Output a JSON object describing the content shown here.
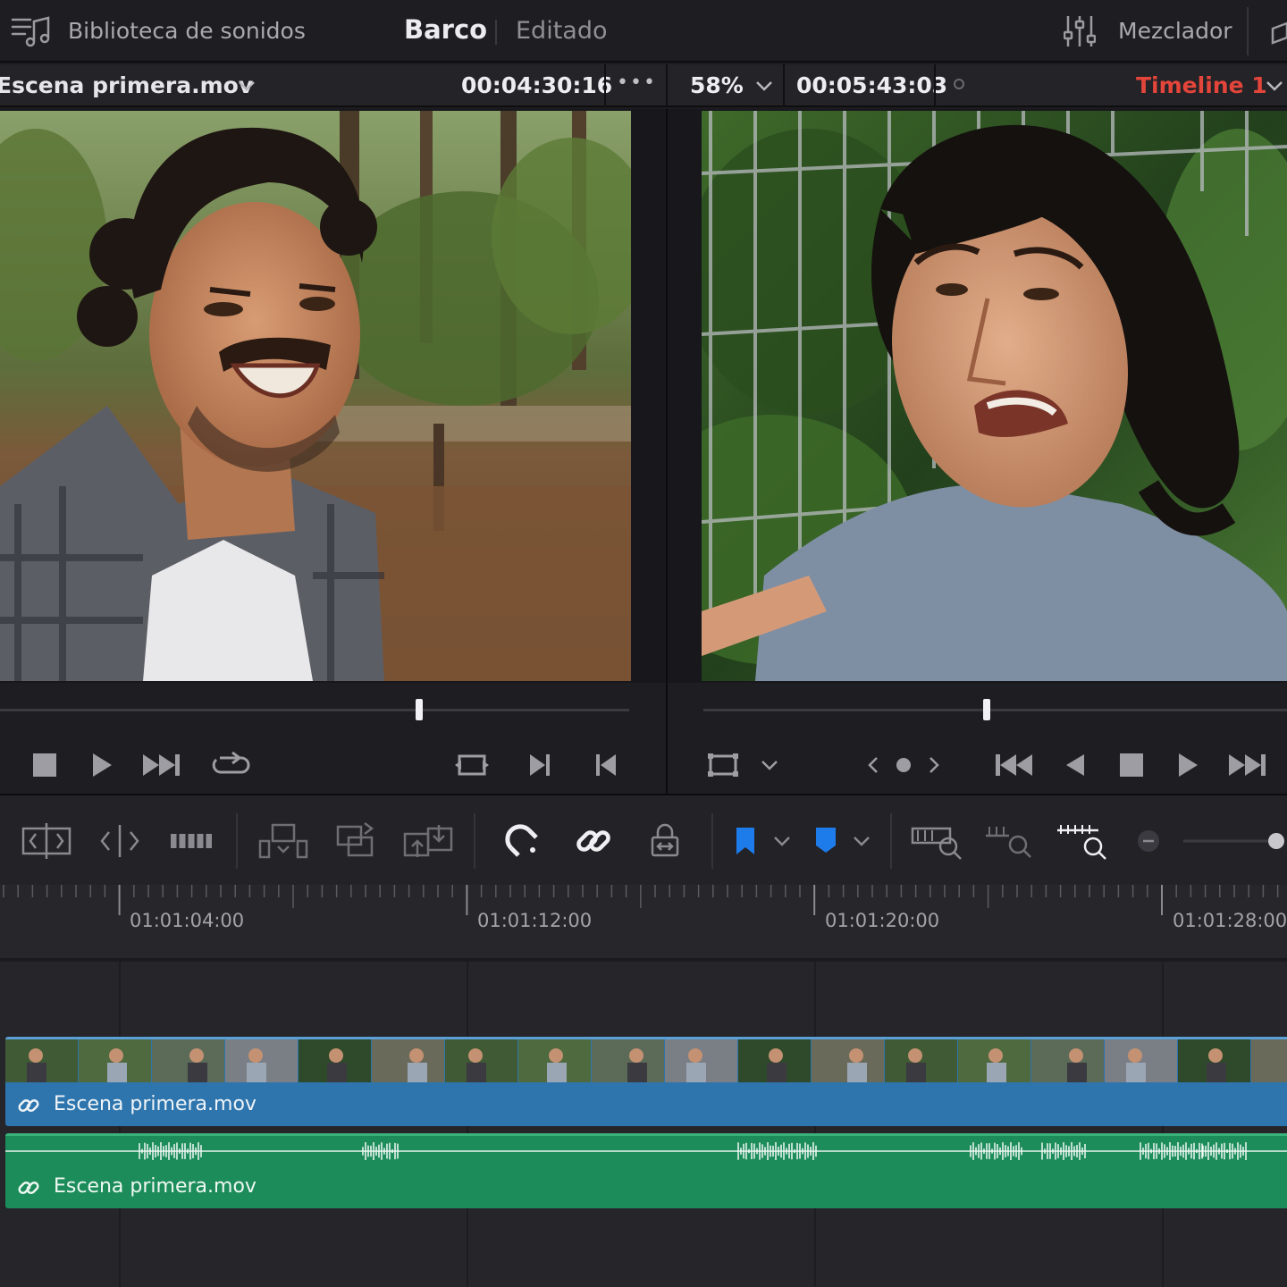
{
  "topbar": {
    "sound_library_label": "Biblioteca de sonidos",
    "page_title": "Barco",
    "page_mode": "Editado",
    "mixer_label": "Mezclador"
  },
  "source_viewer": {
    "clip_name": "Escena primera.mov",
    "timecode": "00:04:30:16",
    "more_label": "•••",
    "playhead_fraction": 0.66
  },
  "timeline_viewer": {
    "zoom": "58%",
    "timecode": "00:05:43:03",
    "timeline_name": "Timeline 1",
    "playhead_fraction": 0.48
  },
  "ruler": {
    "labels": [
      "01:01:04:00",
      "01:01:12:00",
      "01:01:20:00",
      "01:01:28:00"
    ]
  },
  "tracks": {
    "video_clip_name": "Escena primera.mov",
    "audio_clip_name": "Escena primera.mov"
  },
  "colors": {
    "accent_red": "#e3453a",
    "video_clip": "#2e75ad",
    "audio_clip": "#1d8c5b",
    "marker_blue": "#1e7bea"
  }
}
